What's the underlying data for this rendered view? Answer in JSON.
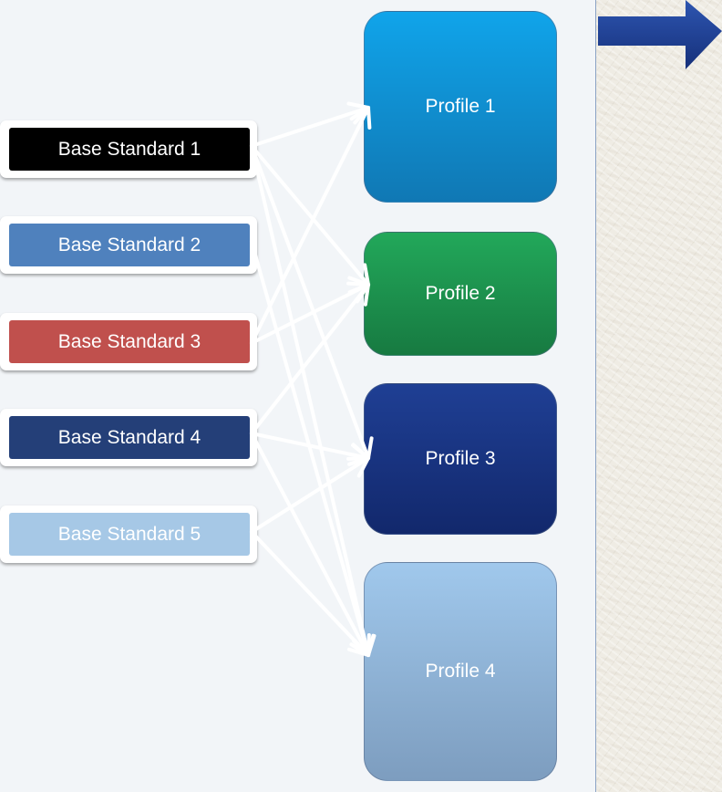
{
  "base_standards": [
    {
      "label": "Base Standard 1",
      "color": "#000000"
    },
    {
      "label": "Base Standard 2",
      "color": "#4f81bd"
    },
    {
      "label": "Base Standard 3",
      "color": "#c0504d"
    },
    {
      "label": "Base Standard 4",
      "color": "#243f78"
    },
    {
      "label": "Base Standard 5",
      "color": "#a6c8e6"
    }
  ],
  "profiles": [
    {
      "label": "Profile 1",
      "color_top": "#10a4ea",
      "color_bottom": "#1078b4"
    },
    {
      "label": "Profile 2",
      "color_top": "#22a85a",
      "color_bottom": "#177a41"
    },
    {
      "label": "Profile 3",
      "color_top": "#1f3f94",
      "color_bottom": "#12286c"
    },
    {
      "label": "Profile 4",
      "color_top": "#a0c8ec",
      "color_bottom": "#7d9dbf"
    }
  ],
  "connections": [
    {
      "from": 1,
      "to": 1
    },
    {
      "from": 1,
      "to": 2
    },
    {
      "from": 1,
      "to": 3
    },
    {
      "from": 1,
      "to": 4
    },
    {
      "from": 2,
      "to": 4
    },
    {
      "from": 3,
      "to": 1
    },
    {
      "from": 3,
      "to": 2
    },
    {
      "from": 4,
      "to": 2
    },
    {
      "from": 4,
      "to": 3
    },
    {
      "from": 4,
      "to": 4
    },
    {
      "from": 5,
      "to": 3
    },
    {
      "from": 5,
      "to": 4
    }
  ],
  "colors": {
    "arrow": "#ffffff",
    "top_arrow": "#1f3d8c",
    "divider": "#8aa2c4"
  }
}
